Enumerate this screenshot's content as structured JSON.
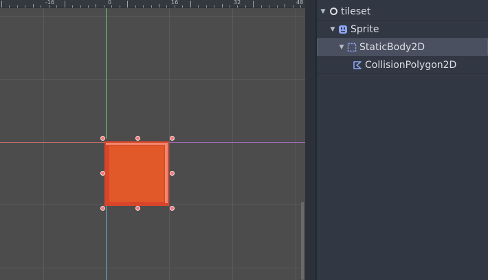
{
  "viewport": {
    "ruler_labels": [
      "-16",
      "0",
      "16",
      "32",
      "48"
    ]
  },
  "scene_tree": {
    "nodes": [
      {
        "label": "tileset",
        "icon": "node-circle-icon",
        "depth": 0,
        "expanded": true
      },
      {
        "label": "Sprite",
        "icon": "sprite-icon",
        "depth": 1,
        "expanded": true
      },
      {
        "label": "StaticBody2D",
        "icon": "static-body-icon",
        "depth": 2,
        "expanded": true,
        "selected": true
      },
      {
        "label": "CollisionPolygon2D",
        "icon": "collision-polygon-icon",
        "depth": 3,
        "expanded": false
      }
    ]
  },
  "colors": {
    "sprite": "#e15928",
    "axis_x": "#c86a6a",
    "axis_y": "#6ec96e",
    "selection_handle": "#f07878",
    "icon_accent": "#8da5f3"
  }
}
